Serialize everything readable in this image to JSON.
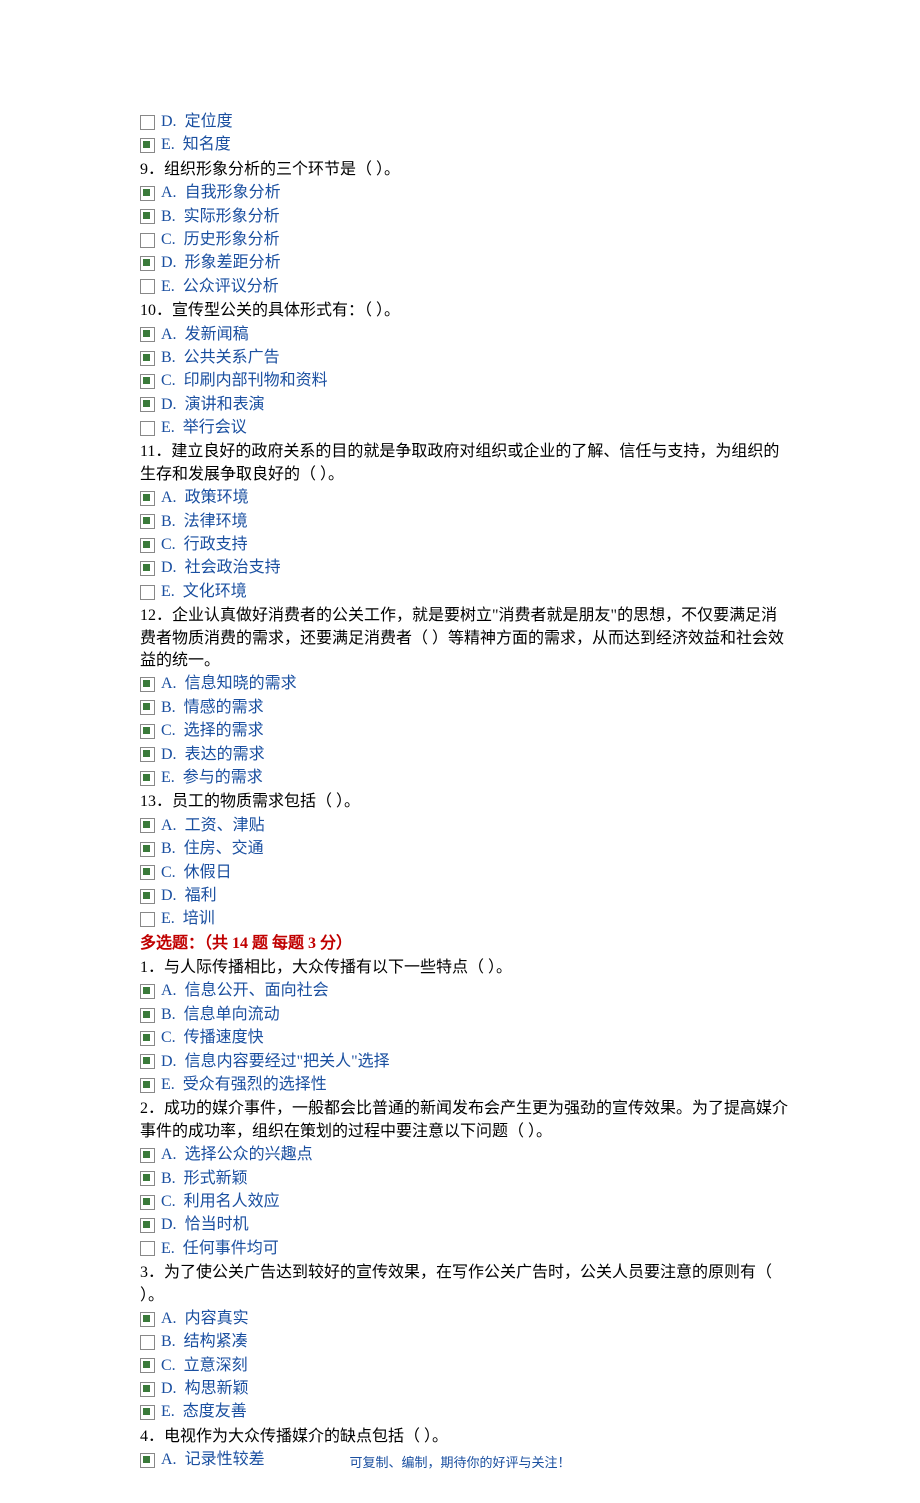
{
  "q8_tail": {
    "options": [
      {
        "label": "D.",
        "text": "定位度",
        "checked": false
      },
      {
        "label": "E.",
        "text": "知名度",
        "checked": true
      }
    ]
  },
  "questions_part1": [
    {
      "num": "9．",
      "text": "组织形象分析的三个环节是（  ）。",
      "options": [
        {
          "label": "A.",
          "text": "自我形象分析",
          "checked": true
        },
        {
          "label": "B.",
          "text": "实际形象分析",
          "checked": true
        },
        {
          "label": "C.",
          "text": "历史形象分析",
          "checked": false
        },
        {
          "label": "D.",
          "text": "形象差距分析",
          "checked": true
        },
        {
          "label": "E.",
          "text": "公众评议分析",
          "checked": false
        }
      ]
    },
    {
      "num": "10．",
      "text": "宣传型公关的具体形式有：（  ）。",
      "options": [
        {
          "label": "A.",
          "text": "发新闻稿",
          "checked": true
        },
        {
          "label": "B.",
          "text": "公共关系广告",
          "checked": true
        },
        {
          "label": "C.",
          "text": "印刷内部刊物和资料",
          "checked": true
        },
        {
          "label": "D.",
          "text": "演讲和表演",
          "checked": true
        },
        {
          "label": "E.",
          "text": "举行会议",
          "checked": false
        }
      ]
    },
    {
      "num": "11．",
      "text": "建立良好的政府关系的目的就是争取政府对组织或企业的了解、信任与支持，为组织的生存和发展争取良好的（  ）。",
      "options": [
        {
          "label": "A.",
          "text": "政策环境",
          "checked": true
        },
        {
          "label": "B.",
          "text": "法律环境",
          "checked": true
        },
        {
          "label": "C.",
          "text": "行政支持",
          "checked": true
        },
        {
          "label": "D.",
          "text": "社会政治支持",
          "checked": true
        },
        {
          "label": "E.",
          "text": "文化环境",
          "checked": false
        }
      ]
    },
    {
      "num": "12．",
      "text": "企业认真做好消费者的公关工作，就是要树立\"消费者就是朋友\"的思想，不仅要满足消费者物质消费的需求，还要满足消费者（  ）等精神方面的需求，从而达到经济效益和社会效益的统一。",
      "options": [
        {
          "label": "A.",
          "text": "信息知晓的需求",
          "checked": true
        },
        {
          "label": "B.",
          "text": "情感的需求",
          "checked": true
        },
        {
          "label": "C.",
          "text": "选择的需求",
          "checked": true
        },
        {
          "label": "D.",
          "text": "表达的需求",
          "checked": true
        },
        {
          "label": "E.",
          "text": "参与的需求",
          "checked": true
        }
      ]
    },
    {
      "num": "13．",
      "text": "员工的物质需求包括（  ）。",
      "options": [
        {
          "label": "A.",
          "text": "工资、津贴",
          "checked": true
        },
        {
          "label": "B.",
          "text": "住房、交通",
          "checked": true
        },
        {
          "label": "C.",
          "text": "休假日",
          "checked": true
        },
        {
          "label": "D.",
          "text": "福利",
          "checked": true
        },
        {
          "label": "E.",
          "text": "培训",
          "checked": false
        }
      ]
    }
  ],
  "section2_header": "多选题：（共 14 题  每题 3 分）",
  "questions_part2": [
    {
      "num": "1．",
      "text": "与人际传播相比，大众传播有以下一些特点（  ）。",
      "options": [
        {
          "label": "A.",
          "text": "信息公开、面向社会",
          "checked": true
        },
        {
          "label": "B.",
          "text": "信息单向流动",
          "checked": true
        },
        {
          "label": "C.",
          "text": "传播速度快",
          "checked": true
        },
        {
          "label": "D.",
          "text": "信息内容要经过\"把关人\"选择",
          "checked": true
        },
        {
          "label": "E.",
          "text": "受众有强烈的选择性",
          "checked": true
        }
      ]
    },
    {
      "num": "2．",
      "text": "成功的媒介事件，一般都会比普通的新闻发布会产生更为强劲的宣传效果。为了提高媒介事件的成功率，组织在策划的过程中要注意以下问题（  ）。",
      "options": [
        {
          "label": "A.",
          "text": "选择公众的兴趣点",
          "checked": true
        },
        {
          "label": "B.",
          "text": "形式新颖",
          "checked": true
        },
        {
          "label": "C.",
          "text": "利用名人效应",
          "checked": true
        },
        {
          "label": "D.",
          "text": "恰当时机",
          "checked": true
        },
        {
          "label": "E.",
          "text": "任何事件均可",
          "checked": false
        }
      ]
    },
    {
      "num": "3．",
      "text": "为了使公关广告达到较好的宣传效果，在写作公关广告时，公关人员要注意的原则有（  ）。",
      "options": [
        {
          "label": "A.",
          "text": "内容真实",
          "checked": true
        },
        {
          "label": "B.",
          "text": "结构紧凑",
          "checked": false
        },
        {
          "label": "C.",
          "text": "立意深刻",
          "checked": true
        },
        {
          "label": "D.",
          "text": "构思新颖",
          "checked": true
        },
        {
          "label": "E.",
          "text": "态度友善",
          "checked": true
        }
      ]
    },
    {
      "num": "4．",
      "text": "电视作为大众传播媒介的缺点包括（  ）。",
      "options": [
        {
          "label": "A.",
          "text": "记录性较差",
          "checked": true
        }
      ]
    }
  ],
  "footer": "可复制、编制，期待你的好评与关注！"
}
